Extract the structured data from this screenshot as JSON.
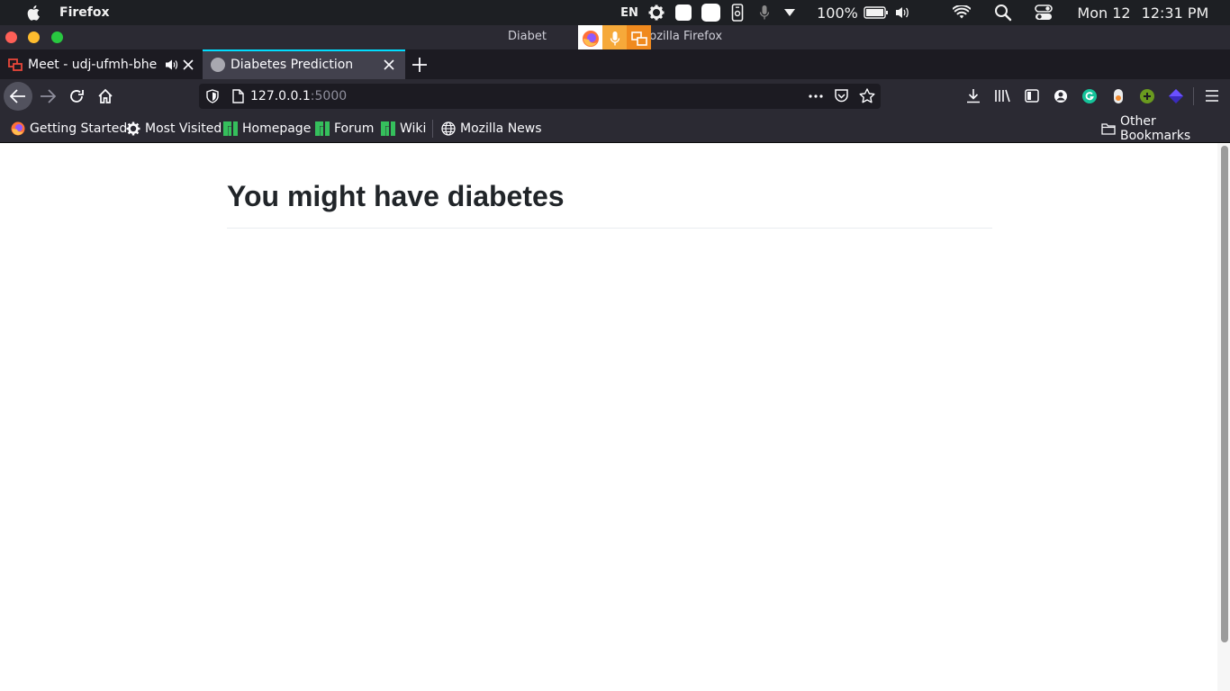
{
  "menubar": {
    "app_name": "Firefox",
    "lang": "EN",
    "battery": "100%",
    "date": "Mon 12",
    "time": "12:31 PM"
  },
  "window": {
    "title_prefix": "Diabet",
    "title_suffix": "— Mozilla Firefox"
  },
  "tabs": [
    {
      "label": "Meet - udj-ufmh-bhe"
    },
    {
      "label": "Diabetes Prediction"
    }
  ],
  "url": {
    "host": "127.0.0.1",
    "port": ":5000"
  },
  "bookmarks": {
    "items": [
      {
        "label": "Getting Started"
      },
      {
        "label": "Most Visited"
      },
      {
        "label": "Homepage"
      },
      {
        "label": "Forum"
      },
      {
        "label": "Wiki"
      },
      {
        "label": "Mozilla News"
      }
    ],
    "other": "Other Bookmarks"
  },
  "page": {
    "heading": "You might have diabetes"
  }
}
